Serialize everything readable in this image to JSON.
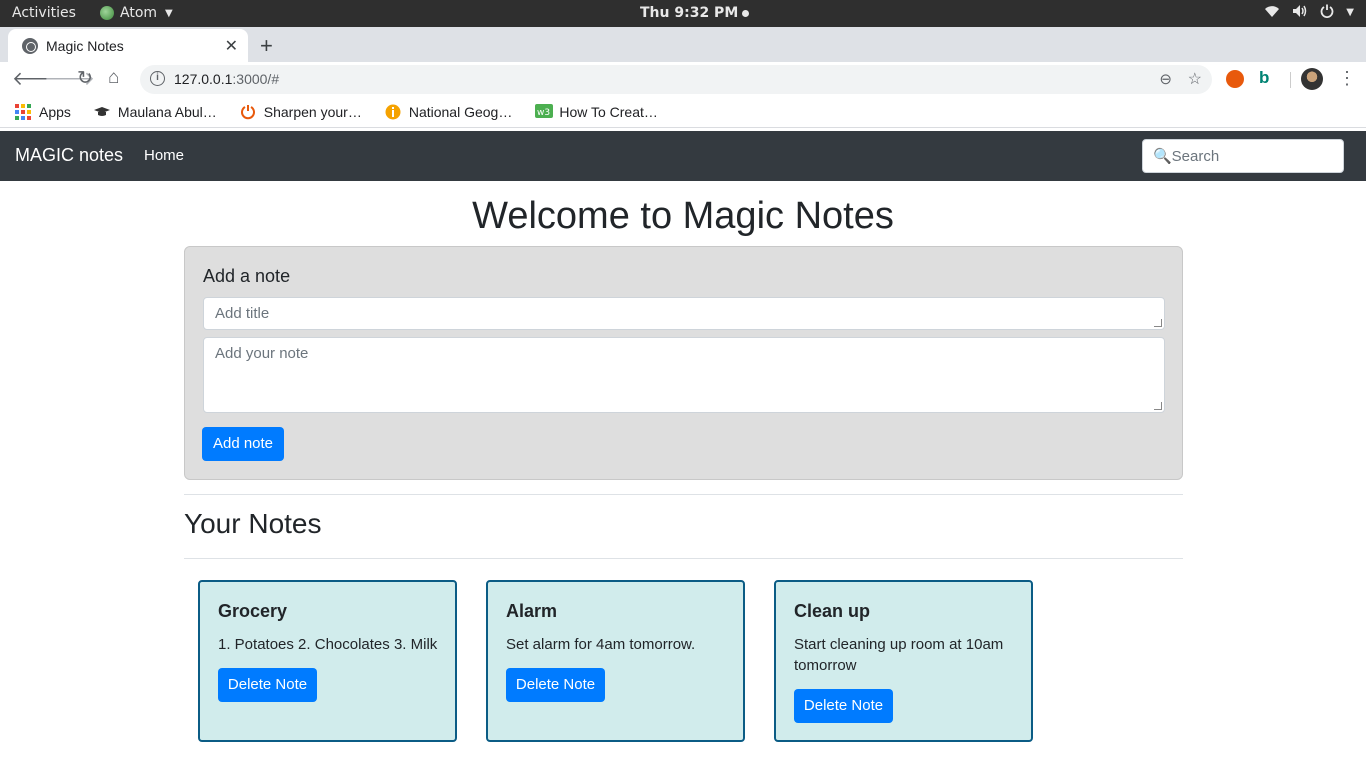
{
  "system_bar": {
    "activities": "Activities",
    "app_name": "Atom",
    "clock": "Thu  9:32 PM"
  },
  "browser": {
    "tab_title": "Magic Notes",
    "url_host": "127.0.0.1",
    "url_path": ":3000/#",
    "bookmarks": [
      {
        "label": "Apps",
        "icon": "apps-grid-icon"
      },
      {
        "label": "Maulana Abul…",
        "icon": "graduation-cap-icon"
      },
      {
        "label": "Sharpen your…",
        "icon": "power-icon"
      },
      {
        "label": "National Geog…",
        "icon": "info-icon"
      },
      {
        "label": "How To Creat…",
        "icon": "w3-icon"
      }
    ]
  },
  "navbar": {
    "brand": "MAGIC notes",
    "home": "Home",
    "search_placeholder": "🔍Search"
  },
  "main": {
    "title": "Welcome to Magic Notes",
    "add_card": {
      "heading": "Add a note",
      "title_placeholder": "Add title",
      "note_placeholder": "Add your note",
      "button": "Add note"
    },
    "notes_heading": "Your Notes",
    "notes": [
      {
        "title": "Grocery",
        "body": "1. Potatoes 2. Chocolates 3. Milk",
        "button": "Delete Note"
      },
      {
        "title": "Alarm",
        "body": "Set alarm for 4am tomorrow.",
        "button": "Delete Note"
      },
      {
        "title": "Clean up",
        "body": "Start cleaning up room at 10am tomorrow",
        "button": "Delete Note"
      }
    ]
  },
  "colors": {
    "navbar_bg": "#343a40",
    "primary": "#007bff",
    "note_bg": "#d1ecec",
    "note_border": "#0b5c85"
  }
}
